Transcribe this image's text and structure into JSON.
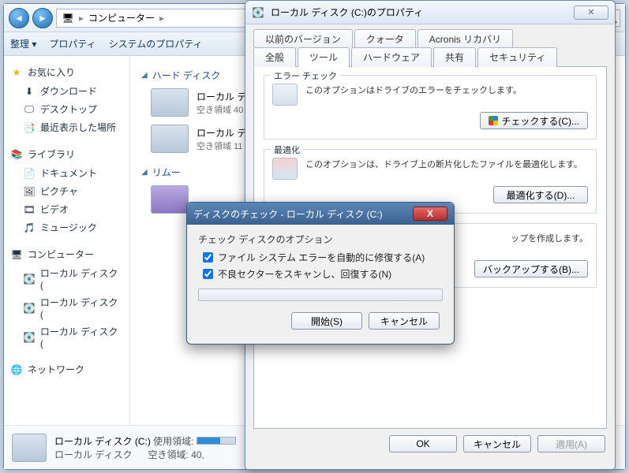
{
  "explorer": {
    "breadcrumb_root": "コンピューター",
    "toolbar": {
      "organize": "整理 ▾",
      "properties": "プロパティ",
      "sysprops": "システムのプロパティ"
    },
    "sidebar": {
      "fav_head": "お気に入り",
      "fav": [
        "ダウンロード",
        "デスクトップ",
        "最近表示した場所"
      ],
      "lib_head": "ライブラリ",
      "lib": [
        "ドキュメント",
        "ピクチャ",
        "ビデオ",
        "ミュージック"
      ],
      "comp_head": "コンピューター",
      "comp": [
        "ローカル ディスク (",
        "ローカル ディスク (",
        "ローカル ディスク ("
      ],
      "net_head": "ネットワーク"
    },
    "sections": {
      "hdd": "ハード ディスク",
      "removable": "リムー"
    },
    "drives": [
      {
        "name": "ローカル ディ",
        "free": "空き領域 40"
      },
      {
        "name": "ローカル ディ",
        "free": "空き領域 11"
      }
    ],
    "floppy": {
      "name": ""
    },
    "status": {
      "name": "ローカル ディスク (C:)",
      "type": "ローカル ディスク",
      "used_label": "使用領域:",
      "free_label": "空き領域:",
      "free_value": "40,"
    }
  },
  "props": {
    "title": "ローカル ディスク (C:)のプロパティ",
    "tabs_row1": [
      "以前のバージョン",
      "クォータ",
      "Acronis リカバリ"
    ],
    "tabs_row2": [
      "全般",
      "ツール",
      "ハードウェア",
      "共有",
      "セキュリティ"
    ],
    "active_tab": "ツール",
    "groups": {
      "error": {
        "legend": "エラー チェック",
        "text": "このオプションはドライブのエラーをチェックします。",
        "button": "チェックする(C)..."
      },
      "defrag": {
        "legend": "最適化",
        "text": "このオプションは、ドライブ上の断片化したファイルを最適化します。",
        "button": "最適化する(D)..."
      },
      "backup": {
        "legend": "",
        "text": "ップを作成します。",
        "button": "バックアップする(B)..."
      }
    },
    "buttons": {
      "ok": "OK",
      "cancel": "キャンセル",
      "apply": "適用(A)"
    }
  },
  "chkdsk": {
    "title": "ディスクのチェック - ローカル ディスク (C:)",
    "options_label": "チェック ディスクのオプション",
    "opt1": "ファイル システム エラーを自動的に修復する(A)",
    "opt2": "不良セクターをスキャンし、回復する(N)",
    "start": "開始(S)",
    "cancel": "キャンセル"
  }
}
